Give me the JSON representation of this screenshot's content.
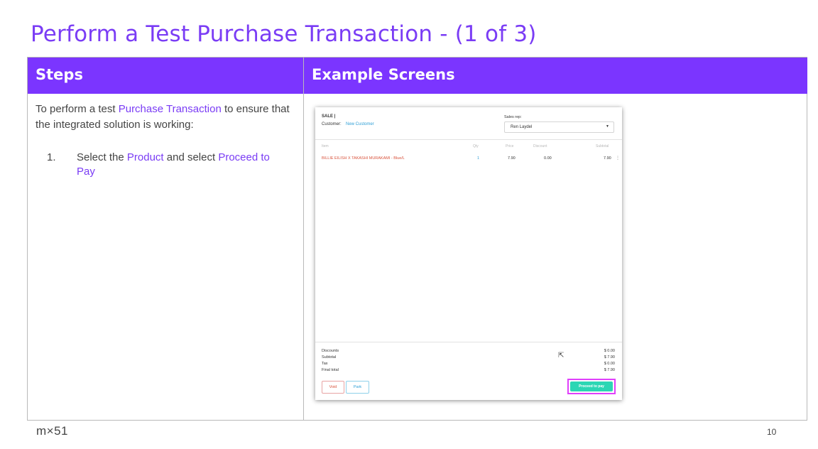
{
  "slide": {
    "title": "Perform a Test Purchase Transaction - (1 of 3)",
    "page_number": "10",
    "logo_text": "m×51"
  },
  "table": {
    "headers": {
      "steps": "Steps",
      "examples": "Example Screens"
    },
    "intro": {
      "prefix": "To perform a test ",
      "highlight": "Purchase Transaction",
      "suffix": " to ensure that the integrated solution is working:"
    },
    "step1": {
      "number": "1.",
      "part1": "Select the ",
      "product": "Product",
      "part2": " and select ",
      "proceed": "Proceed to Pay"
    }
  },
  "pos": {
    "sale_label": "SALE |",
    "customer_label": "Customer:",
    "customer_link": "New Customer",
    "sales_rep_label": "Sales rep:",
    "sales_rep_value": "Ren Laydel",
    "columns": [
      "Item",
      "Qty",
      "Price",
      "Discount",
      "Subtotal"
    ],
    "row": {
      "item": "BILLIE EILISH X TAKASHI MURAKAMI - Blue/L",
      "qty": "1",
      "price": "7.90",
      "discount": "0.00",
      "subtotal": "7.90"
    },
    "totals": [
      {
        "label": "Discounts",
        "value": "$ 0.00"
      },
      {
        "label": "Subtotal",
        "value": "$ 7.90"
      },
      {
        "label": "Tax",
        "value": "$ 0.00"
      },
      {
        "label": "Final total",
        "value": "$ 7.90"
      }
    ],
    "buttons": {
      "void": "Void",
      "park": "Park",
      "proceed": "Proceed to pay"
    }
  },
  "colors": {
    "accent": "#7b35ff",
    "title": "#7a3cf5",
    "proceed": "#2bd6b4",
    "highlight_border": "#e040fb"
  }
}
